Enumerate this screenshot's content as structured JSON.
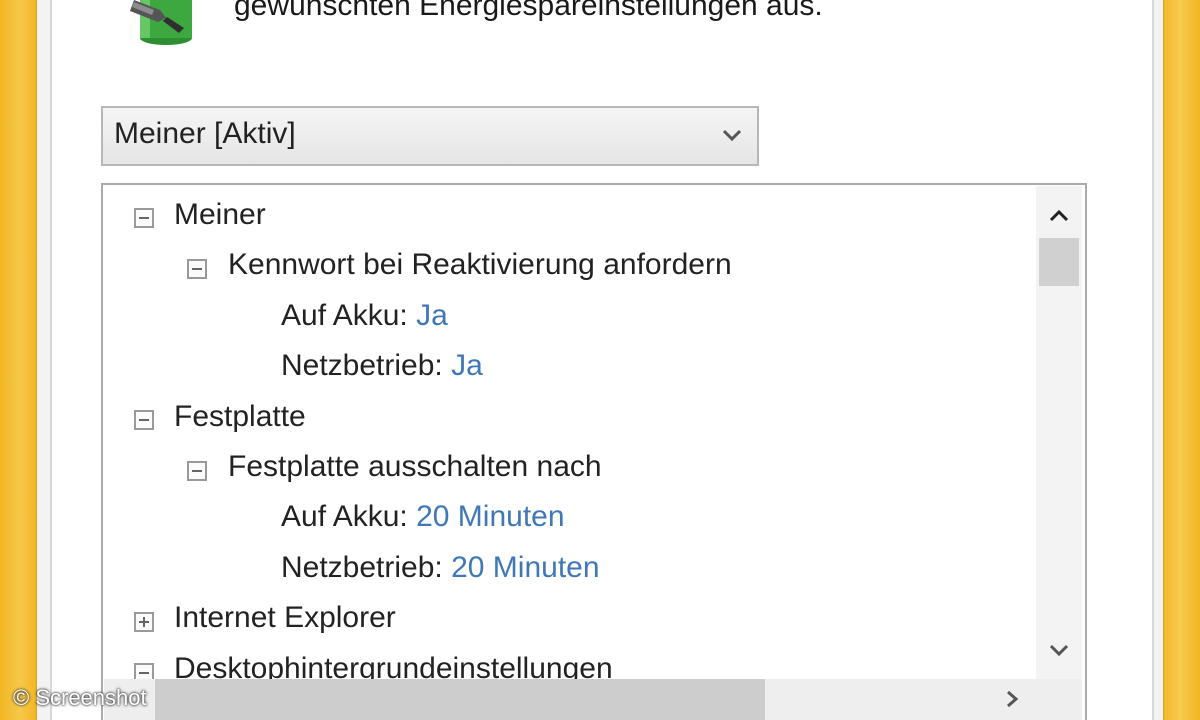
{
  "intro": {
    "text": "gewünschten Energiespareinstellungen aus."
  },
  "plan_select": {
    "selected": "Meiner [Aktiv]"
  },
  "tree": {
    "plan": {
      "label": "Meiner",
      "setting": {
        "label": "Kennwort bei Reaktivierung anfordern",
        "battery_label": "Auf Akku:",
        "battery_value": "Ja",
        "plugged_label": "Netzbetrieb:",
        "plugged_value": "Ja"
      }
    },
    "disk": {
      "label": "Festplatte",
      "setting": {
        "label": "Festplatte ausschalten nach",
        "battery_label": "Auf Akku:",
        "battery_value": "20 Minuten",
        "plugged_label": "Netzbetrieb:",
        "plugged_value": "20 Minuten"
      }
    },
    "ie": {
      "label": "Internet Explorer"
    },
    "desktop_bg": {
      "label": "Desktophintergrundeinstellungen"
    }
  },
  "watermark": {
    "text": "© Screenshot"
  },
  "colors": {
    "window_frame": "#f3b623",
    "value_link": "#3f77b7"
  },
  "icons": {
    "app_icon": "power-plug-battery-icon",
    "dropdown": "chevron-down-icon",
    "collapse": "minus-box-icon",
    "expand": "plus-box-icon"
  }
}
